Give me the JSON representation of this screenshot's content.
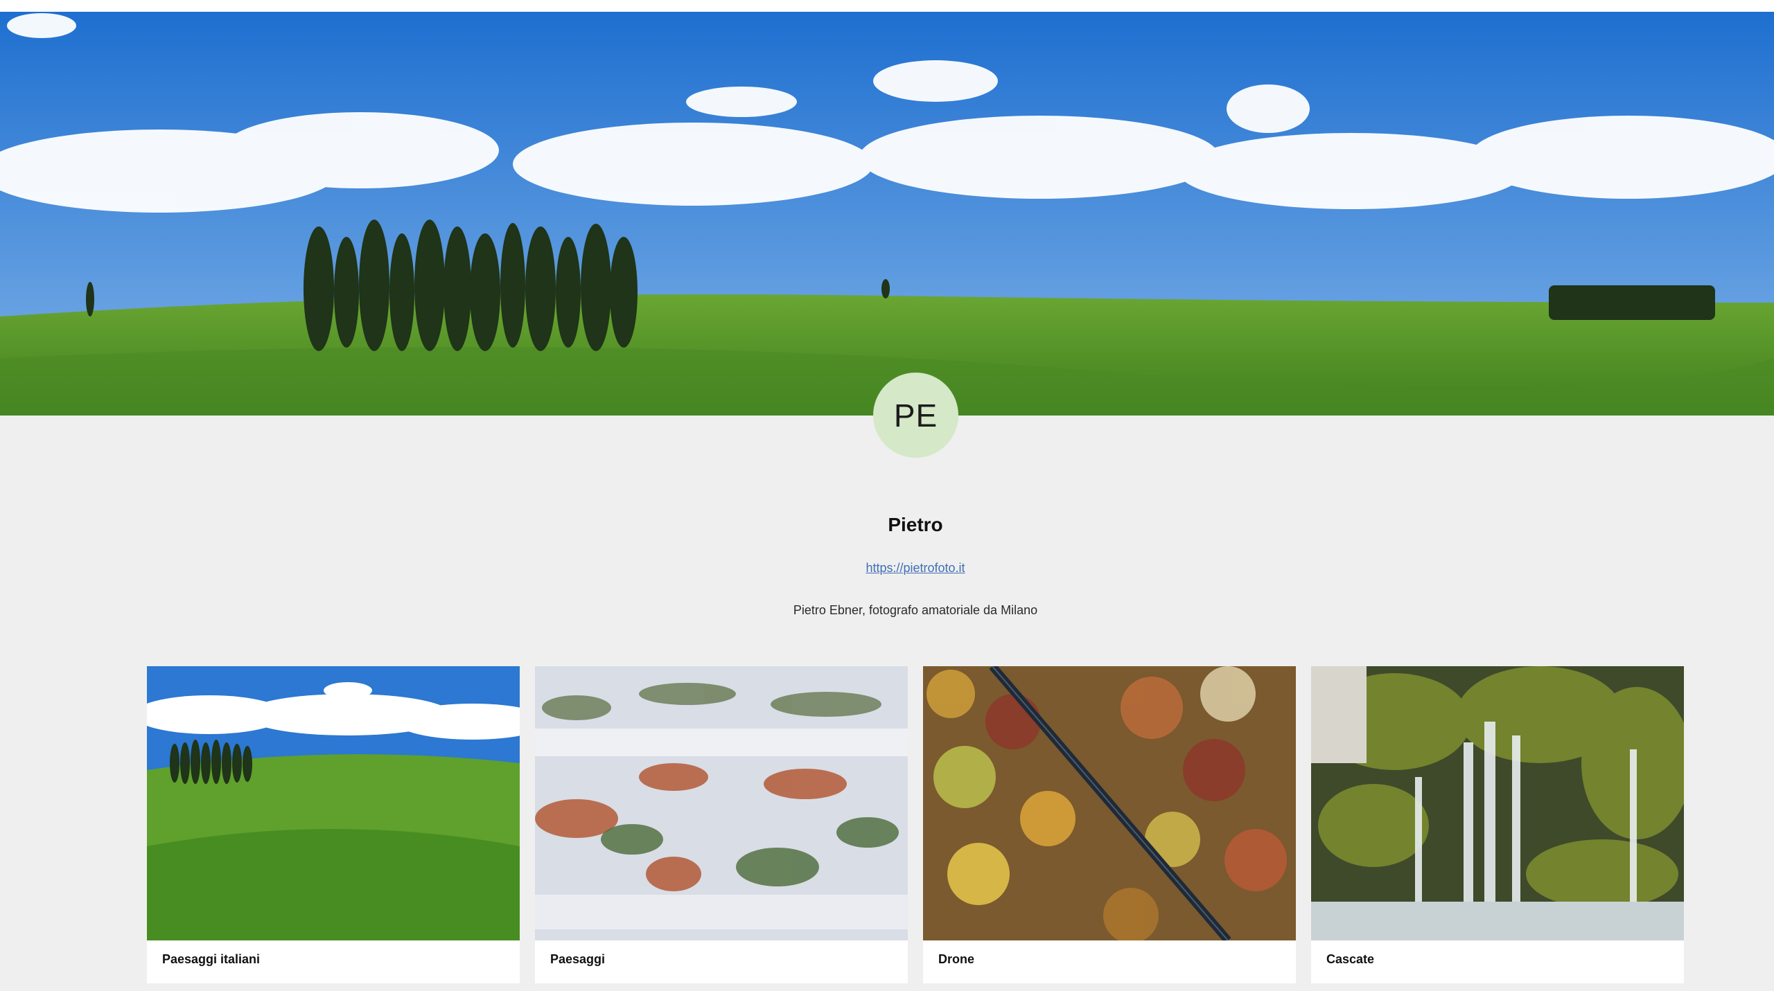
{
  "profile": {
    "initials": "PE",
    "name": "Pietro",
    "website": " https://pietrofoto.it ",
    "bio": "Pietro Ebner, fotografo amatoriale da Milano"
  },
  "albums": [
    {
      "title": "Paesaggi italiani"
    },
    {
      "title": "Paesaggi"
    },
    {
      "title": "Drone"
    },
    {
      "title": "Cascate"
    }
  ],
  "colors": {
    "background": "#efefef",
    "avatar": "#d5e8c8",
    "link": "#3f6fb3"
  }
}
